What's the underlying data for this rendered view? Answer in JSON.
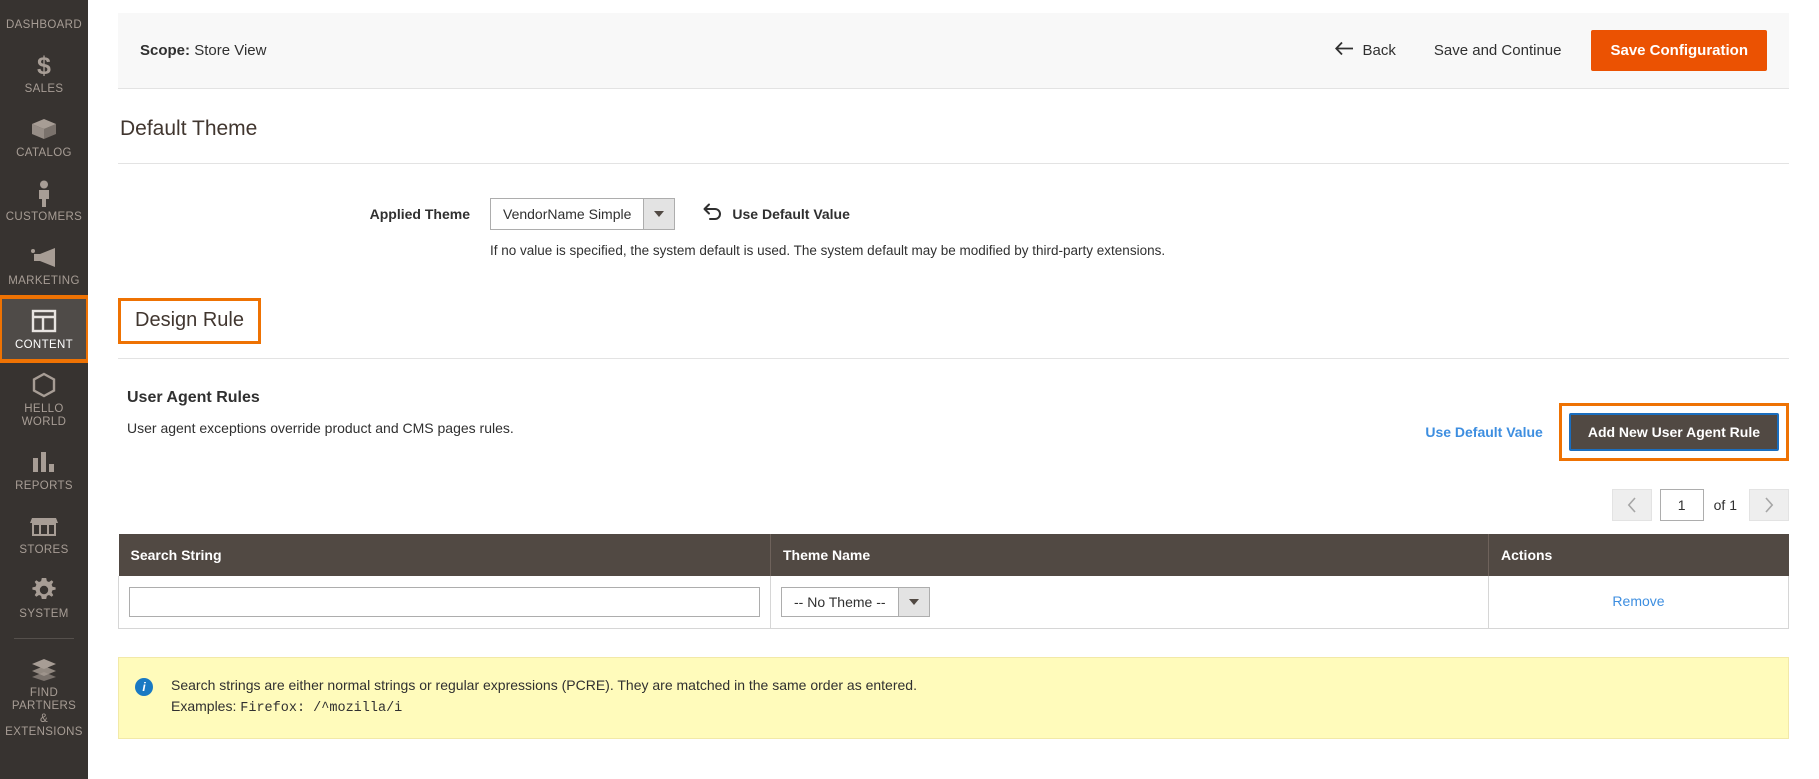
{
  "sidebar": {
    "items": [
      {
        "label": "DASHBOARD",
        "icon": "dashboard-icon",
        "active": false,
        "cut_off": true
      },
      {
        "label": "SALES",
        "icon": "dollar-icon",
        "active": false
      },
      {
        "label": "CATALOG",
        "icon": "box-icon",
        "active": false
      },
      {
        "label": "CUSTOMERS",
        "icon": "person-icon",
        "active": false
      },
      {
        "label": "MARKETING",
        "icon": "megaphone-icon",
        "active": false
      },
      {
        "label": "CONTENT",
        "icon": "layout-icon",
        "active": true
      },
      {
        "label": "HELLO WORLD",
        "icon": "hexagon-icon",
        "active": false
      },
      {
        "label": "REPORTS",
        "icon": "bar-chart-icon",
        "active": false
      },
      {
        "label": "STORES",
        "icon": "storefront-icon",
        "active": false
      },
      {
        "label": "SYSTEM",
        "icon": "gear-icon",
        "active": false
      },
      {
        "label": "FIND PARTNERS\n& EXTENSIONS",
        "icon": "bricks-icon",
        "active": false
      }
    ]
  },
  "page_actions": {
    "scope_label": "Scope:",
    "scope_value": "Store View",
    "back_label": "Back",
    "save_continue_label": "Save and Continue",
    "save_config_label": "Save Configuration"
  },
  "default_theme": {
    "section_title": "Default Theme",
    "applied_theme_label": "Applied Theme",
    "applied_theme_value": "VendorName Simple",
    "use_default_label": "Use Default Value",
    "note": "If no value is specified, the system default is used. The system default may be modified by third-party extensions."
  },
  "design_rule": {
    "title": "Design Rule"
  },
  "user_agent_rules": {
    "title": "User Agent Rules",
    "description": "User agent exceptions override product and CMS pages rules.",
    "use_default_label": "Use Default Value",
    "add_rule_label": "Add New User Agent Rule"
  },
  "pager": {
    "prev_icon": "chevron-left-icon",
    "page_value": "1",
    "of_label": "of 1",
    "next_icon": "chevron-right-icon"
  },
  "grid": {
    "columns": [
      "Search String",
      "Theme Name",
      "Actions"
    ],
    "rows": [
      {
        "search_string": "",
        "search_string_placeholder": "",
        "theme_name": "-- No Theme --",
        "action_label": "Remove"
      }
    ]
  },
  "notice": {
    "icon": "info-icon",
    "line1": "Search strings are either normal strings or regular expressions (PCRE). They are matched in the same order as entered.",
    "line2_prefix": "Examples: ",
    "line2_mono": "Firefox: /^mozilla/i"
  },
  "colors": {
    "brand_orange": "#eb5202",
    "highlight_orange": "#ee7203",
    "sidebar_bg": "#373330",
    "grid_header": "#514943",
    "link_blue": "#3d8ee0",
    "notice_bg": "#fffbbb",
    "info_blue": "#1979c3"
  }
}
